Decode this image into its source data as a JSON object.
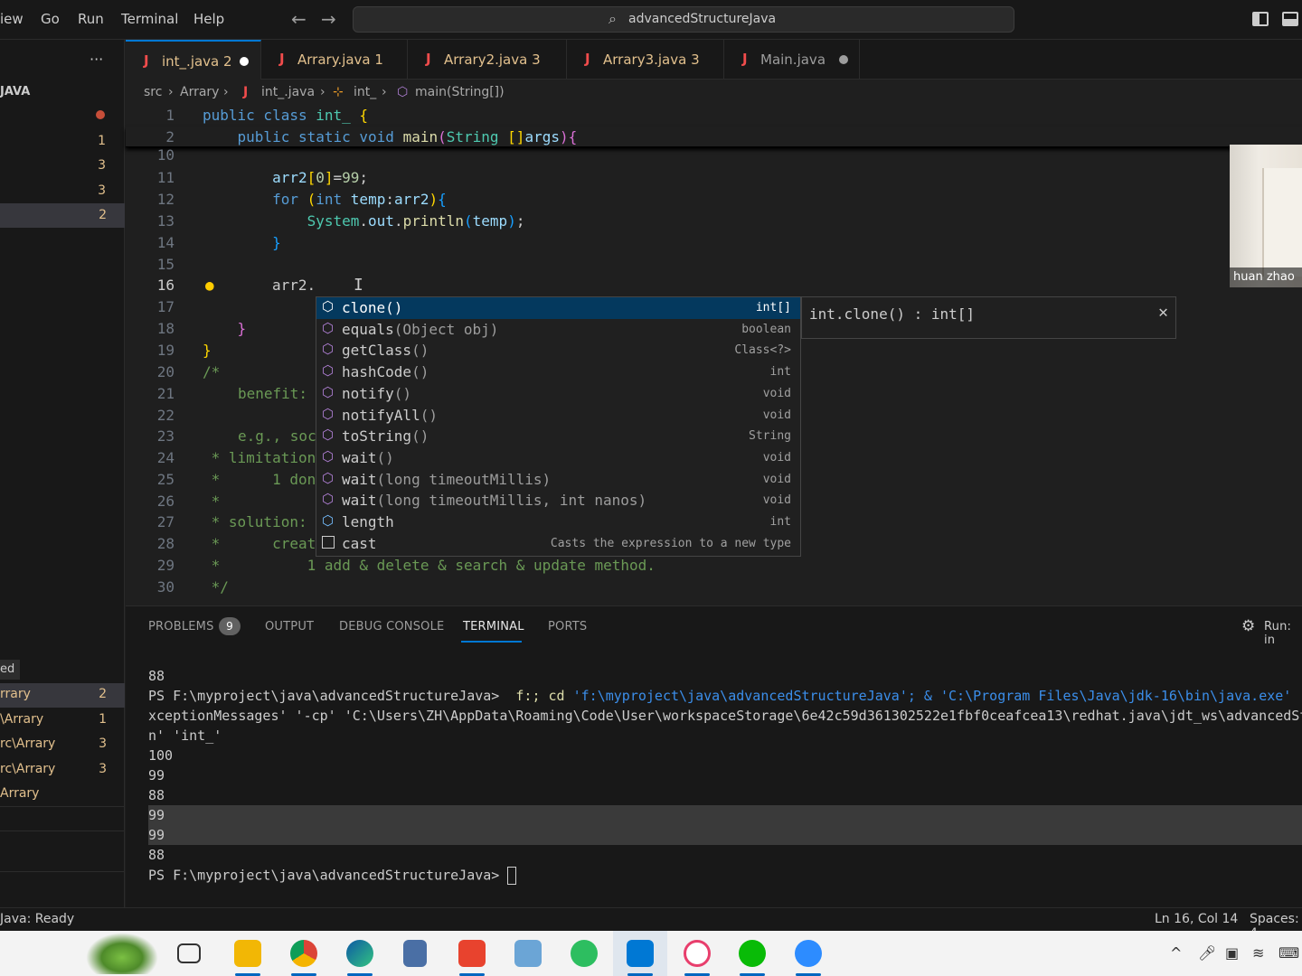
{
  "menu": [
    "iew",
    "Go",
    "Run",
    "Terminal",
    "Help"
  ],
  "search": {
    "text": "advancedStructureJava"
  },
  "sidebar": {
    "more": "···",
    "section": "JAVA",
    "counts": [
      "1",
      "3",
      "3",
      "2"
    ],
    "bottom_header": "ed",
    "rows": [
      {
        "label": "rrary",
        "num": "2"
      },
      {
        "label": "\\Arrary",
        "num": "1"
      },
      {
        "label": "rc\\Arrary",
        "num": "3"
      },
      {
        "label": "rc\\Arrary",
        "num": "3"
      },
      {
        "label": "Arrary",
        "num": ""
      }
    ]
  },
  "tabs": [
    {
      "name": "int_.java  2",
      "modified": true
    },
    {
      "name": "Arrary.java  1",
      "modified": false
    },
    {
      "name": "Arrary2.java  3",
      "modified": false
    },
    {
      "name": "Arrary3.java  3",
      "modified": false
    },
    {
      "name": "Main.java",
      "modified": true
    }
  ],
  "breadcrumb": [
    "src",
    "Arrary",
    "int_.java",
    "int_",
    "main(String[])"
  ],
  "editor": {
    "line_numbers": [
      "1",
      "2",
      "10",
      "11",
      "12",
      "13",
      "14",
      "15",
      "16",
      "17",
      "18",
      "19",
      "20",
      "21",
      "22",
      "23",
      "24",
      "25",
      "26",
      "27",
      "28",
      "29",
      "30"
    ],
    "typed": "arr2.",
    "comment_fragments": {
      "benefit": "benefit:",
      "eg": "e.g., soc",
      "limitation": " * limitation",
      "don": " *      1 don",
      "star": " *",
      "solution": " * solution:",
      "creat": " *      creat",
      "add": " *          1 add & delete & search & update method.",
      "end": " */"
    }
  },
  "suggest": {
    "items": [
      {
        "name": "clone",
        "params": "()",
        "type": "int[]",
        "icon": "method-icon"
      },
      {
        "name": "equals",
        "params": "(Object obj)",
        "type": "boolean",
        "icon": "method-icon"
      },
      {
        "name": "getClass",
        "params": "()",
        "type": "Class<?>",
        "icon": "method-icon"
      },
      {
        "name": "hashCode",
        "params": "()",
        "type": "int",
        "icon": "method-icon"
      },
      {
        "name": "notify",
        "params": "()",
        "type": "void",
        "icon": "method-icon"
      },
      {
        "name": "notifyAll",
        "params": "()",
        "type": "void",
        "icon": "method-icon"
      },
      {
        "name": "toString",
        "params": "()",
        "type": "String",
        "icon": "method-icon"
      },
      {
        "name": "wait",
        "params": "()",
        "type": "void",
        "icon": "method-icon"
      },
      {
        "name": "wait",
        "params": "(long timeoutMillis)",
        "type": "void",
        "icon": "method-icon"
      },
      {
        "name": "wait",
        "params": "(long timeoutMillis, int nanos)",
        "type": "void",
        "icon": "method-icon"
      },
      {
        "name": "length",
        "params": "",
        "type": "int",
        "icon": "field-icon"
      },
      {
        "name": "cast",
        "params": "",
        "type": "Casts the expression to a new type",
        "icon": "snippet-icon"
      }
    ],
    "detail": "int.clone() : int[]"
  },
  "video": {
    "name": "huan zhao"
  },
  "panel": {
    "tabs": [
      "PROBLEMS",
      "OUTPUT",
      "DEBUG CONSOLE",
      "TERMINAL",
      "PORTS"
    ],
    "problems_count": "9",
    "run_label": "Run: in",
    "terminal": {
      "line0": "88",
      "prompt": "PS F:\\myproject\\java\\advancedStructureJava> ",
      "cmd1": "f:; cd ",
      "str1": "'f:\\myproject\\java\\advancedStructureJava'; & 'C:\\Program Files\\Java\\jdk-16\\bin\\java.exe' '",
      "line2": "xceptionMessages' '-cp' 'C:\\Users\\ZH\\AppData\\Roaming\\Code\\User\\workspaceStorage\\6e42c59d361302522e1fbf0ceafcea13\\redhat.java\\jdt_ws\\advancedSt",
      "line3": "n' 'int_'",
      "output": [
        "100",
        "99",
        "88",
        "99",
        "99",
        "88"
      ],
      "final_prompt": "PS F:\\myproject\\java\\advancedStructureJava> "
    }
  },
  "status": {
    "left": "Java: Ready",
    "position": "Ln 16, Col 14",
    "spaces": "Spaces: 4"
  },
  "taskbar": {
    "apps": [
      "frog-wallpaper-icon",
      "task-view-icon",
      "file-explorer-icon",
      "chrome-icon",
      "edge-icon",
      "calculator-icon",
      "wps-icon",
      "notepad-icon",
      "evernote-icon",
      "vscode-icon",
      "snipping-tool-icon",
      "wechat-icon",
      "zoom-icon"
    ]
  }
}
